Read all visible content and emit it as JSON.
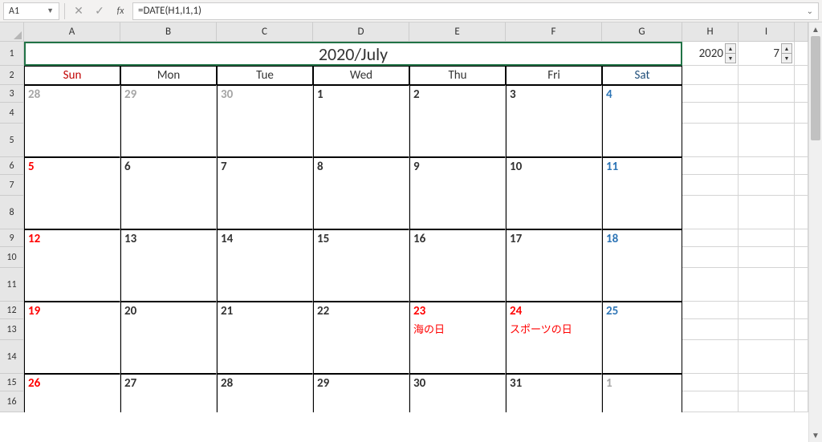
{
  "formula_bar": {
    "name_box": "A1",
    "formula": "=DATE(H1,I1,1)"
  },
  "columns": [
    "A",
    "B",
    "C",
    "D",
    "E",
    "F",
    "G",
    "H",
    "I"
  ],
  "calendar": {
    "title": "2020/July",
    "year_spinner": "2020",
    "month_spinner": "7",
    "dow": [
      "Sun",
      "Mon",
      "Tue",
      "Wed",
      "Thu",
      "Fri",
      "Sat"
    ],
    "weeks": [
      [
        {
          "n": "28",
          "cls": "graytxt"
        },
        {
          "n": "29",
          "cls": "graytxt"
        },
        {
          "n": "30",
          "cls": "graytxt"
        },
        {
          "n": "1",
          "cls": ""
        },
        {
          "n": "2",
          "cls": ""
        },
        {
          "n": "3",
          "cls": ""
        },
        {
          "n": "4",
          "cls": "bluetxt"
        }
      ],
      [
        {
          "n": "5",
          "cls": "redtxt"
        },
        {
          "n": "6",
          "cls": ""
        },
        {
          "n": "7",
          "cls": ""
        },
        {
          "n": "8",
          "cls": ""
        },
        {
          "n": "9",
          "cls": ""
        },
        {
          "n": "10",
          "cls": ""
        },
        {
          "n": "11",
          "cls": "bluetxt"
        }
      ],
      [
        {
          "n": "12",
          "cls": "redtxt"
        },
        {
          "n": "13",
          "cls": ""
        },
        {
          "n": "14",
          "cls": ""
        },
        {
          "n": "15",
          "cls": ""
        },
        {
          "n": "16",
          "cls": ""
        },
        {
          "n": "17",
          "cls": ""
        },
        {
          "n": "18",
          "cls": "bluetxt"
        }
      ],
      [
        {
          "n": "19",
          "cls": "redtxt"
        },
        {
          "n": "20",
          "cls": ""
        },
        {
          "n": "21",
          "cls": ""
        },
        {
          "n": "22",
          "cls": ""
        },
        {
          "n": "23",
          "cls": "redtxt",
          "txt": "海の日"
        },
        {
          "n": "24",
          "cls": "redtxt",
          "txt": "スポーツの日"
        },
        {
          "n": "25",
          "cls": "bluetxt"
        }
      ],
      [
        {
          "n": "26",
          "cls": "redtxt"
        },
        {
          "n": "27",
          "cls": ""
        },
        {
          "n": "28",
          "cls": ""
        },
        {
          "n": "29",
          "cls": ""
        },
        {
          "n": "30",
          "cls": ""
        },
        {
          "n": "31",
          "cls": ""
        },
        {
          "n": "1",
          "cls": "graytxt"
        }
      ]
    ]
  }
}
